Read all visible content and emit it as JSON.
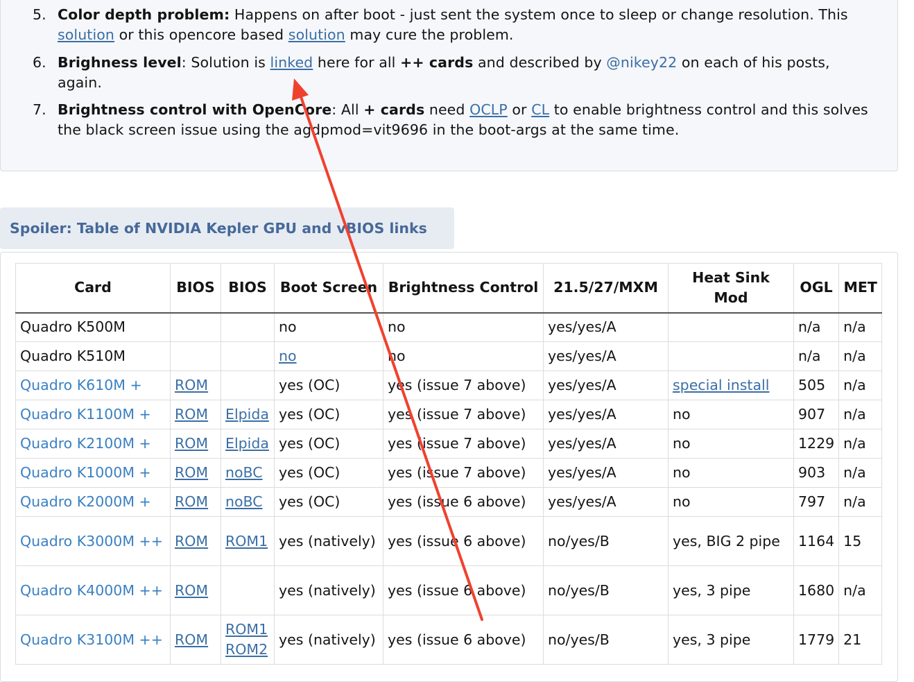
{
  "notes": {
    "item5": {
      "num": "5.",
      "title": "Color depth problem:",
      "text1": " Happens on after boot - just sent the system once to sleep or change resolution. This ",
      "link1": "solution",
      "text2": " or this opencore based ",
      "link2": "solution",
      "text3": " may cure the problem."
    },
    "item6": {
      "num": "6.",
      "title": "Brighness level",
      "text1": ": Solution is ",
      "link": "linked",
      "text2": " here for all ",
      "bold": "++ cards",
      "text3": " and described by ",
      "mention": "@nikey22",
      "text4": " on each of his posts, again."
    },
    "item7": {
      "num": "7.",
      "title": "Brightness control with OpenCore",
      "text1": ": All ",
      "bold": "+ cards",
      "text2": " need ",
      "link1": "OCLP",
      "text3": " or ",
      "link2": "CL",
      "text4": " to enable brightness control and this solves the black screen issue using the agdpmod=vit9696 in the boot-args at the same time."
    }
  },
  "spoiler": {
    "label": "Spoiler: Table of NVIDIA Kepler GPU and vBIOS links"
  },
  "table": {
    "headers": [
      "Card",
      "BIOS",
      "BIOS",
      "Boot Screen",
      "Brightness Control",
      "21.5/27/MXM",
      "Heat Sink Mod",
      "OGL",
      "MET"
    ],
    "rows": [
      {
        "card": "Quadro K500M",
        "bios1": "",
        "bios2": "",
        "bios2b": "",
        "boot": "no",
        "bright": "no",
        "mxm": "yes/yes/A",
        "heat": "",
        "ogl": "n/a",
        "met": "n/a"
      },
      {
        "card": "Quadro K510M",
        "bios1": "",
        "bios2": "",
        "bios2b": "",
        "boot": "no",
        "bright": "no",
        "mxm": "yes/yes/A",
        "heat": "",
        "ogl": "n/a",
        "met": "n/a"
      },
      {
        "card": "Quadro K610M +",
        "bios1": "ROM",
        "bios2": "",
        "bios2b": "",
        "boot": "yes (OC)",
        "bright": "yes (issue 7 above)",
        "mxm": "yes/yes/A",
        "heat": "special install",
        "ogl": "505",
        "met": "n/a"
      },
      {
        "card": "Quadro K1100M +",
        "bios1": "ROM",
        "bios2": "Elpida",
        "bios2b": "",
        "boot": "yes (OC)",
        "bright": "yes (issue 7 above)",
        "mxm": "yes/yes/A",
        "heat": "no",
        "ogl": "907",
        "met": "n/a"
      },
      {
        "card": "Quadro K2100M +",
        "bios1": "ROM",
        "bios2": "Elpida",
        "bios2b": "",
        "boot": "yes (OC)",
        "bright": "yes (issue 7 above)",
        "mxm": "yes/yes/A",
        "heat": "no",
        "ogl": "1229",
        "met": "n/a"
      },
      {
        "card": "Quadro K1000M +",
        "bios1": "ROM",
        "bios2": "noBC",
        "bios2b": "",
        "boot": "yes (OC)",
        "bright": "yes (issue 7 above)",
        "mxm": "yes/yes/A",
        "heat": "no",
        "ogl": "903",
        "met": "n/a"
      },
      {
        "card": "Quadro K2000M +",
        "bios1": "ROM",
        "bios2": "noBC",
        "bios2b": "",
        "boot": "yes (OC)",
        "bright": "yes (issue 6 above)",
        "mxm": "yes/yes/A",
        "heat": "no",
        "ogl": "797",
        "met": "n/a"
      },
      {
        "card": "Quadro K3000M ++",
        "bios1": "ROM",
        "bios2": "ROM1",
        "bios2b": "",
        "boot": "yes (natively)",
        "bright": "yes (issue 6 above)",
        "mxm": "no/yes/B",
        "heat": "yes, BIG 2 pipe",
        "ogl": "1164",
        "met": "15"
      },
      {
        "card": "Quadro K4000M ++",
        "bios1": "ROM",
        "bios2": "",
        "bios2b": "",
        "boot": "yes (natively)",
        "bright": "yes (issue 6 above)",
        "mxm": "no/yes/B",
        "heat": "yes, 3 pipe",
        "ogl": "1680",
        "met": "n/a"
      },
      {
        "card": "Quadro K3100M ++",
        "bios1": "ROM",
        "bios2": "ROM1",
        "bios2b": "ROM2",
        "boot": "yes (natively)",
        "bright": "yes (issue 6 above)",
        "mxm": "no/yes/B",
        "heat": "yes, 3 pipe",
        "ogl": "1779",
        "met": "21"
      }
    ]
  },
  "colors": {
    "link": "#3a6ea5",
    "card_link": "#3a80c2",
    "annotation_arrow": "#f0412f"
  }
}
